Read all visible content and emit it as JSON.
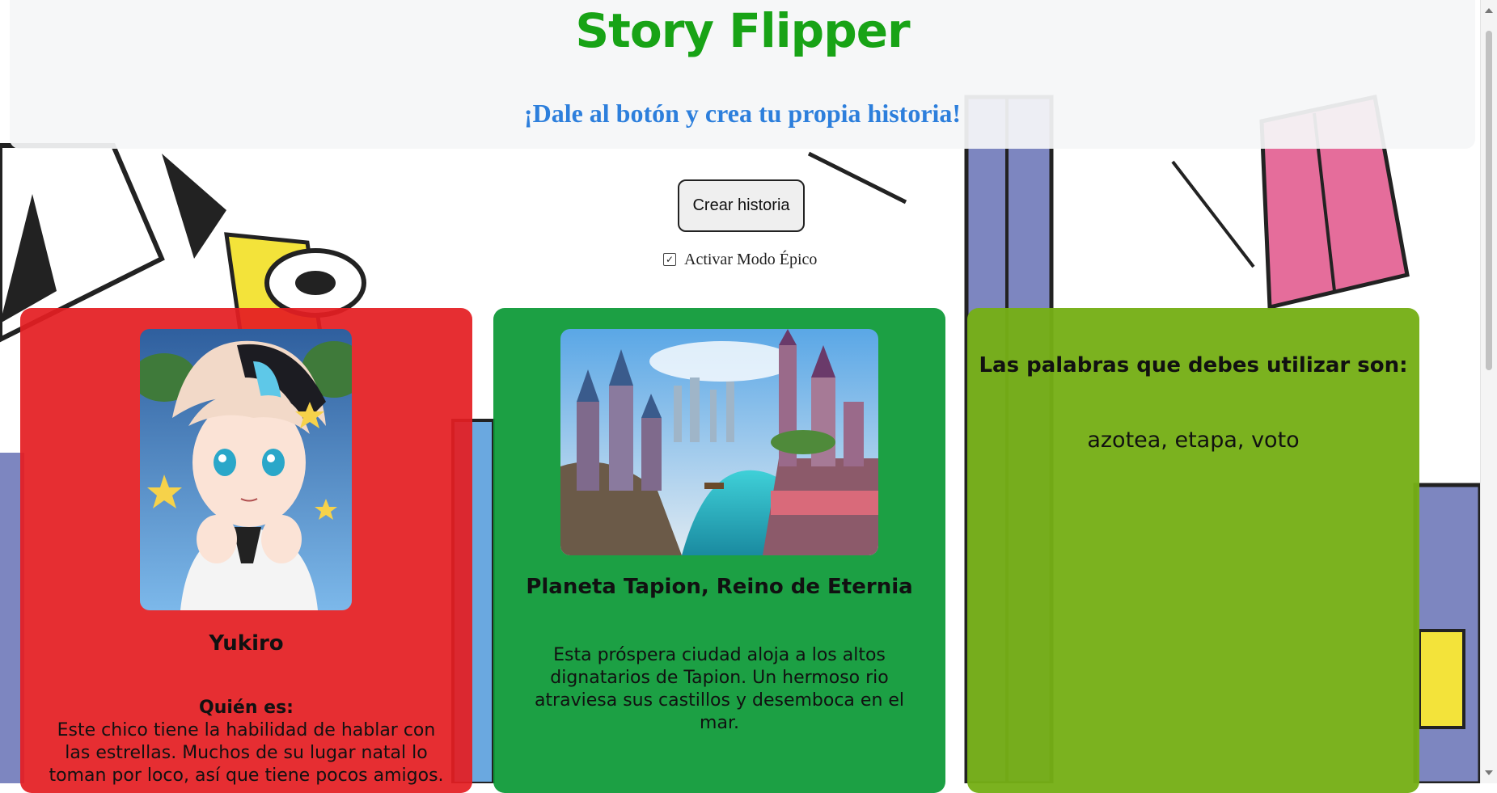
{
  "header": {
    "title": "Story Flipper",
    "subtitle": "¡Dale al botón y crea tu propia historia!"
  },
  "controls": {
    "create_label": "Crear historia",
    "epic_mode_label": "Activar Modo Épico",
    "epic_mode_checked": true
  },
  "character_card": {
    "image_name": "anime-boy-portrait",
    "name": "Yukiro",
    "who_label": "Quién es:",
    "description": "Este chico tiene la habilidad de hablar con las estrellas. Muchos de su lugar natal lo toman por loco, así que tiene pocos amigos."
  },
  "place_card": {
    "image_name": "fantasy-castle-city",
    "name": "Planeta Tapion, Reino de Eternia",
    "description": "Esta próspera ciudad aloja a los altos dignatarios de Tapion. Un hermoso rio atraviesa sus castillos y desemboca en el mar."
  },
  "words_card": {
    "heading": "Las palabras que debes utilizar son:",
    "words": "azotea, etapa, voto"
  },
  "colors": {
    "title": "#18a316",
    "subtitle": "#2d7fdc",
    "character_card": "#e41e22",
    "place_card": "#109b3a",
    "words_card": "#76af16"
  }
}
